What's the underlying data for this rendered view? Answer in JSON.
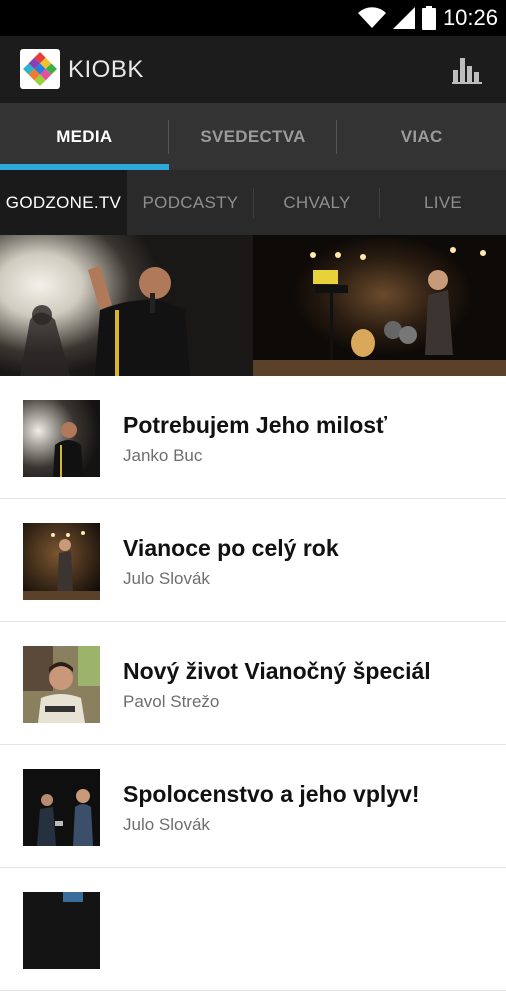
{
  "status": {
    "time": "10:26"
  },
  "app": {
    "title": "KIOBK"
  },
  "tabs": [
    {
      "label": "MEDIA",
      "active": true
    },
    {
      "label": "SVEDECTVA",
      "active": false
    },
    {
      "label": "VIAC",
      "active": false
    }
  ],
  "subtabs": [
    {
      "label": "GODZONE.TV",
      "active": true
    },
    {
      "label": "PODCASTY",
      "active": false
    },
    {
      "label": "CHVALY",
      "active": false
    },
    {
      "label": "LIVE",
      "active": false
    }
  ],
  "items": [
    {
      "title": "Potrebujem Jeho milosť",
      "author": "Janko Buc"
    },
    {
      "title": "Vianoce po celý rok",
      "author": "Julo Slovák"
    },
    {
      "title": "Nový život Vianočný špeciál",
      "author": "Pavol Strežo"
    },
    {
      "title": "Spolocenstvo a jeho vplyv!",
      "author": "Julo Slovák"
    }
  ],
  "colors": {
    "accent": "#2fa8dc",
    "appbar": "#1c1c1c",
    "tabs": "#333333"
  }
}
